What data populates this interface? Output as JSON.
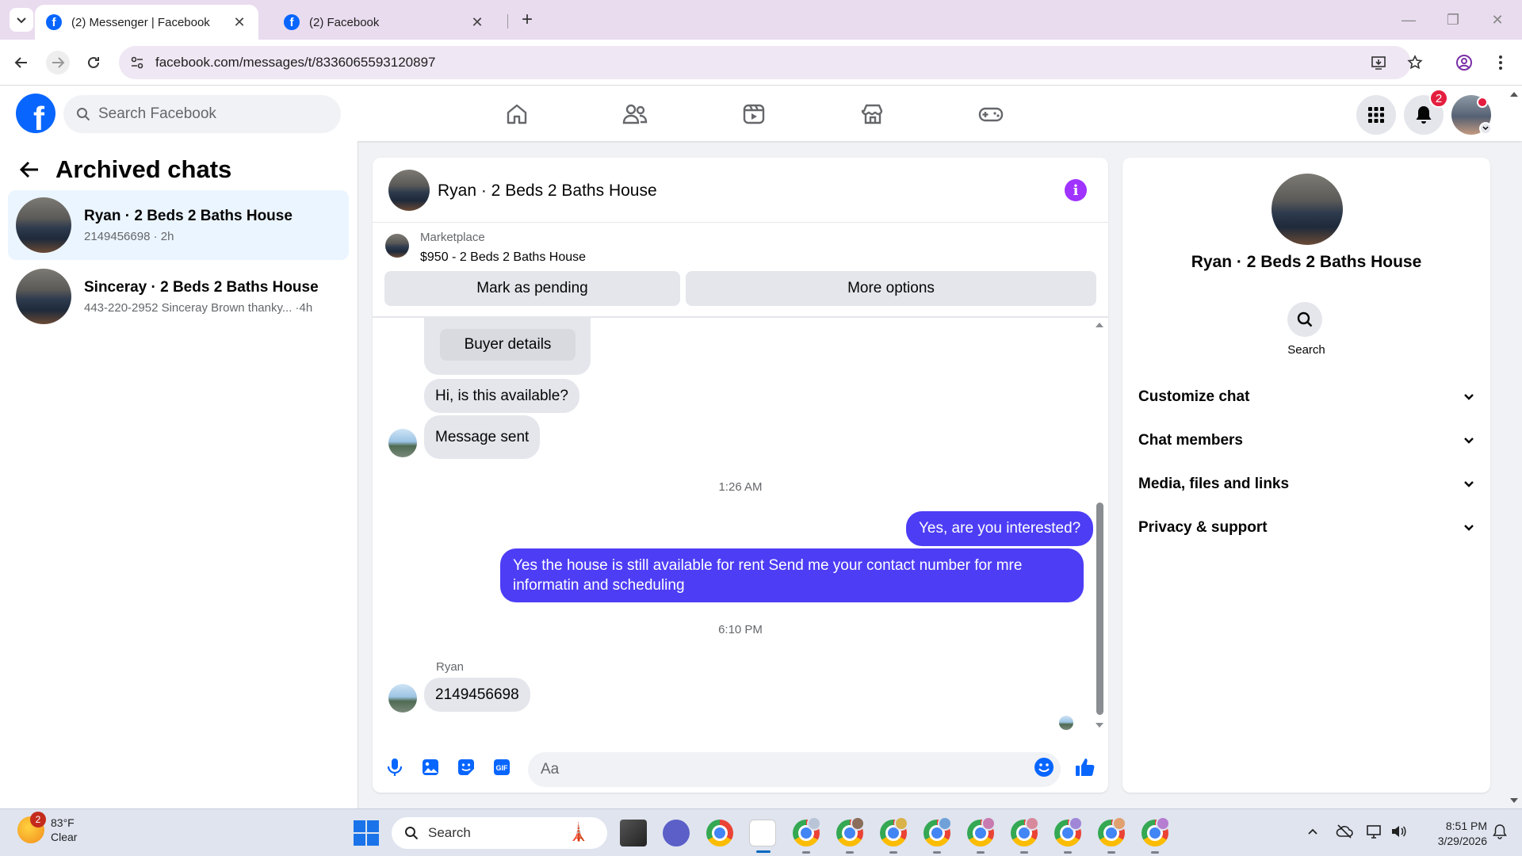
{
  "browser": {
    "tabs": [
      {
        "label": "(2) Messenger | Facebook",
        "active": true
      },
      {
        "label": "(2) Facebook",
        "active": false
      }
    ],
    "url": "facebook.com/messages/t/8336065593120897"
  },
  "header": {
    "search_placeholder": "Search Facebook",
    "notification_count": "2",
    "nav_icons": [
      "home-icon",
      "friends-icon",
      "video-icon",
      "marketplace-icon",
      "gaming-icon"
    ]
  },
  "sidebar": {
    "title": "Archived chats",
    "chats": [
      {
        "name": "Ryan · 2 Beds 2 Baths House",
        "preview": "2149456698 · 2h",
        "active": true
      },
      {
        "name": "Sinceray · 2 Beds 2 Baths House",
        "preview": "443-220-2952 Sinceray Brown thanky... ·4h",
        "active": false
      }
    ]
  },
  "conversation": {
    "title": "Ryan · 2 Beds 2 Baths House",
    "marketplace_label": "Marketplace",
    "listing": "$950 - 2 Beds 2 Baths House",
    "mark_pending_label": "Mark as pending",
    "more_options_label": "More options",
    "buyer_details_label": "Buyer details",
    "messages": {
      "in_1": "Hi, is this available?",
      "in_2": "Message sent",
      "ts_1": "1:26 AM",
      "out_1": "Yes, are you interested?",
      "out_2": "Yes the house is still available for rent Send me your contact number for mre informatin and  scheduling",
      "ts_2": "6:10 PM",
      "sender": "Ryan",
      "in_3": "2149456698"
    },
    "composer_placeholder": "Aa"
  },
  "info_pane": {
    "name": "Ryan · 2 Beds 2 Baths House",
    "search_label": "Search",
    "sections": [
      "Customize chat",
      "Chat members",
      "Media, files and links",
      "Privacy & support"
    ]
  },
  "taskbar": {
    "weather_badge": "2",
    "temperature": "83°F",
    "condition": "Clear",
    "search_label": "Search",
    "time": "8:51 PM",
    "date": "3/29/2026"
  },
  "colors": {
    "fb_blue": "#0866ff",
    "outgoing_bubble": "#4d3df5",
    "info_purple": "#a033ff",
    "notification_red": "#e41e3f"
  }
}
